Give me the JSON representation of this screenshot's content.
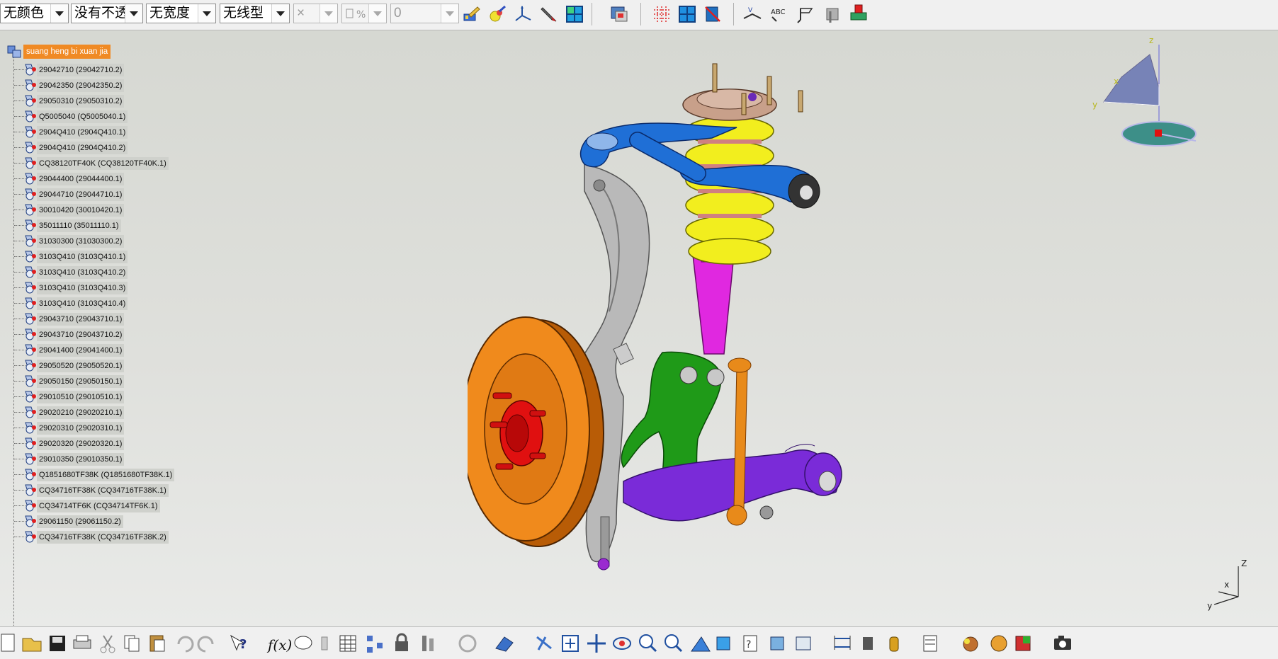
{
  "toolbar": {
    "color_value": "无颜色",
    "transparency_value": "没有不透",
    "linewidth_value": "无宽度",
    "linetype_value": "无线型",
    "point_value": "×",
    "layer_value": "0",
    "icons": [
      "paint-brush-icon",
      "apply-material-icon",
      "axis-system-icon",
      "pencil-icon",
      "grid-view-icon",
      "catalog-icon",
      "snap-grid-icon",
      "plane-grid-icon",
      "dimension-icon",
      "annotation-icon",
      "text-icon",
      "flag-note-icon",
      "3d-annotation-icon",
      "measure-icon"
    ]
  },
  "tree": {
    "root": "suang heng bi xuan jia",
    "items": [
      "29042710 (29042710.2)",
      "29042350 (29042350.2)",
      "29050310 (29050310.2)",
      "Q5005040 (Q5005040.1)",
      "2904Q410 (2904Q410.1)",
      "2904Q410 (2904Q410.2)",
      "CQ38120TF40K (CQ38120TF40K.1)",
      "29044400 (29044400.1)",
      "29044710 (29044710.1)",
      "30010420 (30010420.1)",
      "35011110 (35011110.1)",
      "31030300 (31030300.2)",
      "3103Q410 (3103Q410.1)",
      "3103Q410 (3103Q410.2)",
      "3103Q410 (3103Q410.3)",
      "3103Q410 (3103Q410.4)",
      "29043710 (29043710.1)",
      "29043710 (29043710.2)",
      "29041400 (29041400.1)",
      "29050520 (29050520.1)",
      "29050150 (29050150.1)",
      "29010510 (29010510.1)",
      "29020210 (29020210.1)",
      "29020310 (29020310.1)",
      "29020320 (29020320.1)",
      "29010350 (29010350.1)",
      "Q1851680TF38K (Q1851680TF38K.1)",
      "CQ34716TF38K (CQ34716TF38K.1)",
      "CQ34714TF6K (CQ34714TF6K.1)",
      "29061150 (29061150.2)",
      "CQ34716TF38K (CQ34716TF38K.2)"
    ]
  },
  "compass": {
    "x": "x",
    "y": "y",
    "z": "z"
  },
  "axis": {
    "x": "x",
    "y": "y",
    "z": "Z"
  },
  "colors": {
    "root_highlight": "#f08a24",
    "brake_disc": "#f08a1c",
    "spring": "#f2ee1e",
    "upper_arm": "#1f6fd6",
    "lower_arm": "#7a2bd8",
    "knuckle": "#1c8a14",
    "damper": "#e028e0",
    "hub": "#e01010"
  }
}
